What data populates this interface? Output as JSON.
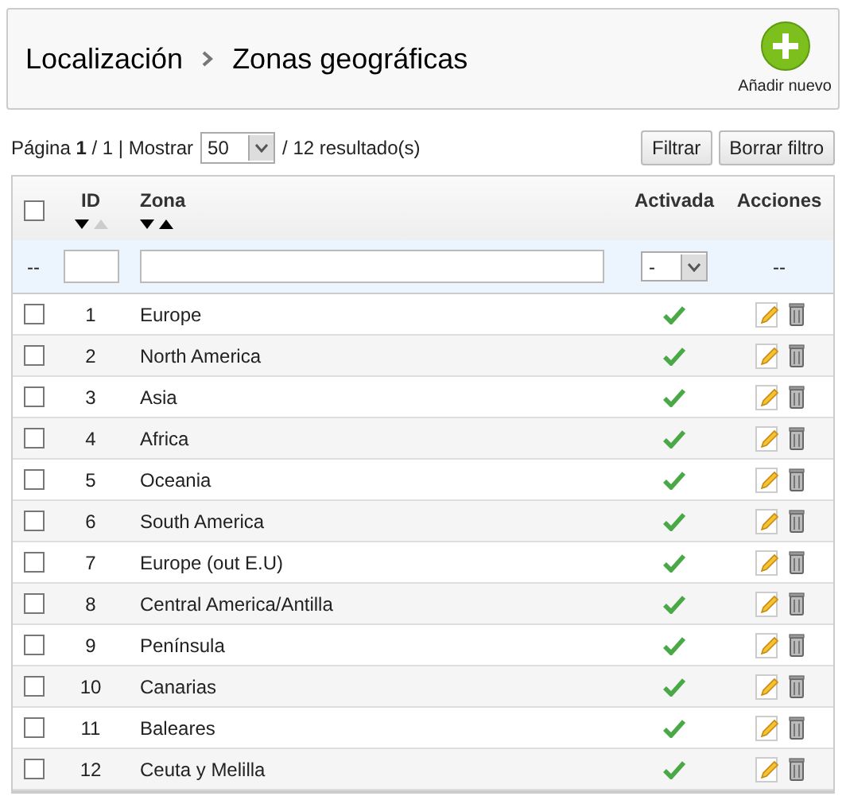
{
  "breadcrumb": [
    "Localización",
    "Zonas geográficas"
  ],
  "add_button": {
    "label": "Añadir nuevo"
  },
  "pagination": {
    "text": "Página **1** / 1 | Mostrar",
    "per_page": "50",
    "results": "/ 12 resultado(s)"
  },
  "buttons": [
    "Filtrar",
    "Borrar filtro"
  ],
  "table": {
    "select_all_checked": false,
    "columns": [
      {
        "label": "ID",
        "sort_down_enabled": true,
        "sort_up_enabled": false
      },
      {
        "label": "Zona",
        "sort_down_enabled": true,
        "sort_up_enabled": true
      },
      {
        "label": "Activada"
      },
      {
        "label": "Acciones"
      }
    ],
    "filter": {
      "select_text": "--",
      "active_value": "-",
      "actions_text": "--"
    },
    "rows": [
      {
        "id": "1",
        "zone": "Europe",
        "active": true,
        "checked": false
      },
      {
        "id": "2",
        "zone": "North America",
        "active": true,
        "checked": false
      },
      {
        "id": "3",
        "zone": "Asia",
        "active": true,
        "checked": false
      },
      {
        "id": "4",
        "zone": "Africa",
        "active": true,
        "checked": false
      },
      {
        "id": "5",
        "zone": "Oceania",
        "active": true,
        "checked": false
      },
      {
        "id": "6",
        "zone": "South America",
        "active": true,
        "checked": false
      },
      {
        "id": "7",
        "zone": "Europe (out E.U)",
        "active": true,
        "checked": false
      },
      {
        "id": "8",
        "zone": "Central America/Antilla",
        "active": true,
        "checked": false
      },
      {
        "id": "9",
        "zone": "Península",
        "active": true,
        "checked": false
      },
      {
        "id": "10",
        "zone": "Canarias",
        "active": true,
        "checked": false
      },
      {
        "id": "11",
        "zone": "Baleares",
        "active": true,
        "checked": false
      },
      {
        "id": "12",
        "zone": "Ceuta y Melilla",
        "active": true,
        "checked": false
      }
    ]
  }
}
